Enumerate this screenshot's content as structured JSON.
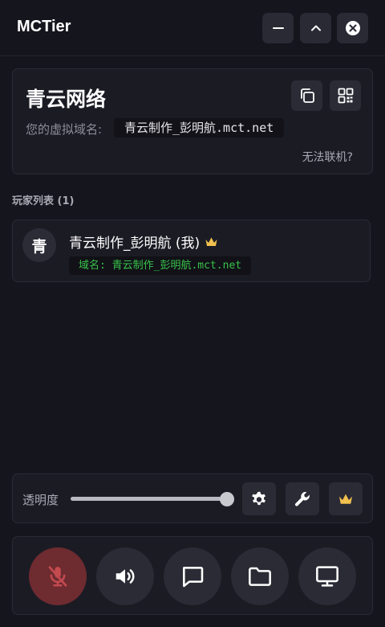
{
  "app": {
    "title": "MCTier"
  },
  "network": {
    "name": "青云网络",
    "domain_label": "您的虚拟域名:",
    "domain_value": "青云制作_彭明航.mct.net",
    "help_link": "无法联机?"
  },
  "players": {
    "title": "玩家列表 (1)",
    "items": [
      {
        "avatar": "青",
        "name": "青云制作_彭明航 (我)",
        "domain": "域名: 青云制作_彭明航.mct.net",
        "host_icon": "crown-icon"
      }
    ]
  },
  "opacity": {
    "label": "透明度",
    "value_percent": 100
  },
  "colors": {
    "accent_gold": "#f2c14e",
    "domain_green": "#38c24a",
    "mic_off_bg": "#6e2b30",
    "mic_off_icon": "#c34a4f"
  },
  "icons": {
    "titlebar": [
      "minimize-icon",
      "collapse-icon",
      "close-icon"
    ],
    "card": [
      "copy-icon",
      "qr-code-icon"
    ],
    "options": [
      "gear-icon",
      "wrench-icon",
      "crown-icon"
    ],
    "controls": [
      "mic-off-icon",
      "speaker-icon",
      "chat-icon",
      "folder-icon",
      "monitor-icon"
    ]
  }
}
